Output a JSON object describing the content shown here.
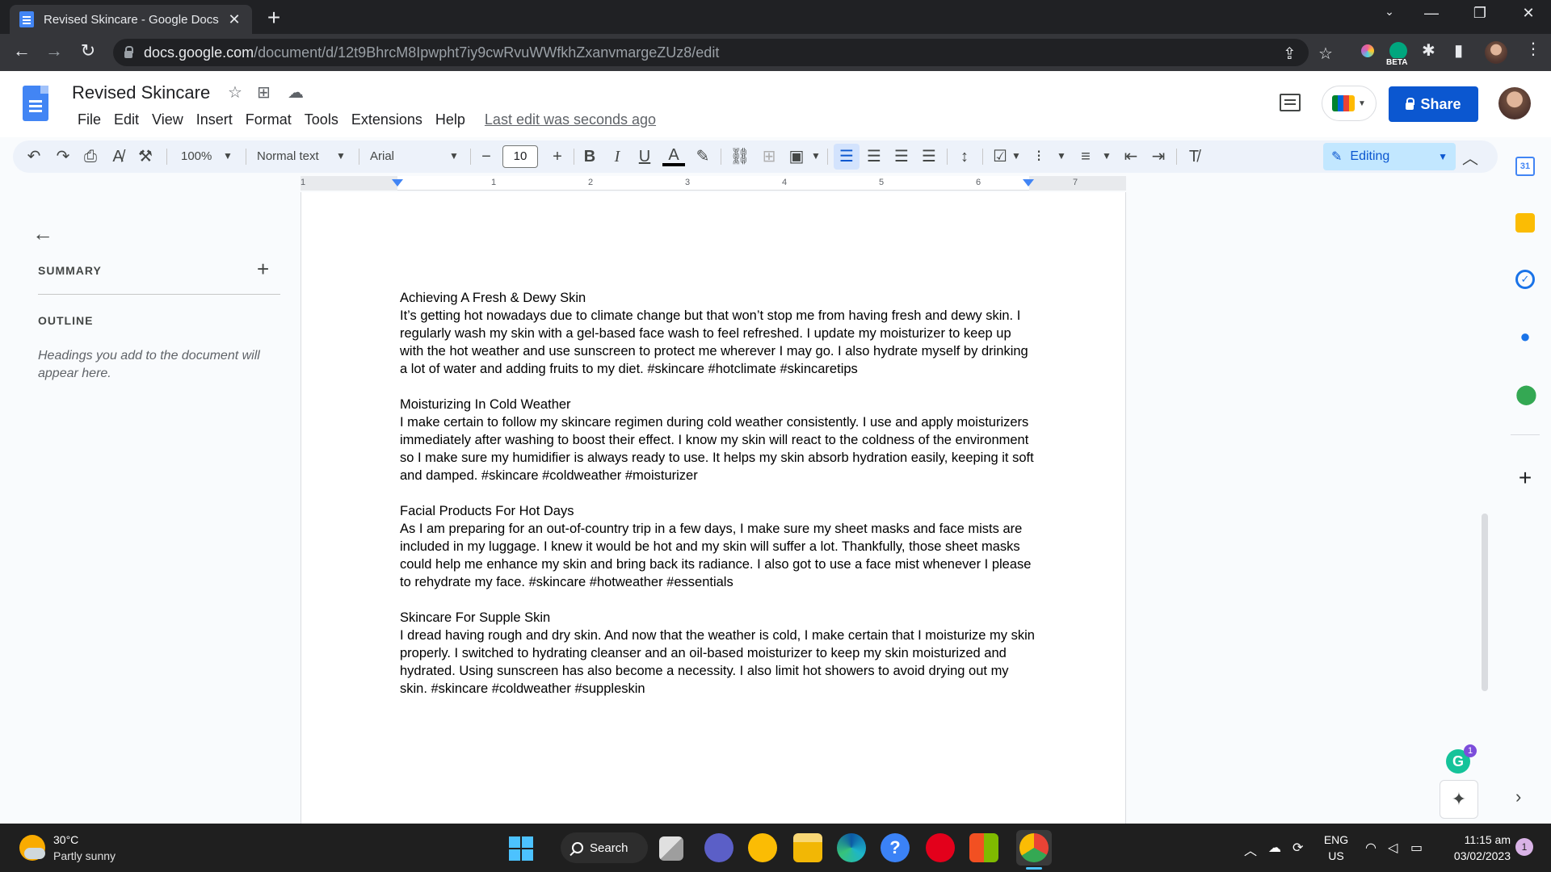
{
  "browser": {
    "tab_title": "Revised Skincare - Google Docs",
    "tab_close": "✕",
    "new_tab": "+",
    "url_host": "docs.google.com",
    "url_path": "/document/d/12t9BhrcM8Ipwpht7iy9cwRvuWWfkhZxanvmargeZUz8/edit",
    "ext_beta_label": "BETA"
  },
  "docs": {
    "title": "Revised Skincare",
    "menu": [
      "File",
      "Edit",
      "View",
      "Insert",
      "Format",
      "Tools",
      "Extensions",
      "Help"
    ],
    "last_edit": "Last edit was seconds ago",
    "share_label": "Share"
  },
  "toolbar": {
    "zoom": "100%",
    "style": "Normal text",
    "font": "Arial",
    "font_size": "10",
    "mode": "Editing"
  },
  "ruler": {
    "numbers": [
      "1",
      "1",
      "2",
      "3",
      "4",
      "5",
      "6",
      "7"
    ]
  },
  "sidebar": {
    "summary_label": "SUMMARY",
    "outline_label": "OUTLINE",
    "outline_hint": "Headings you add to the document will appear here."
  },
  "document": {
    "sections": [
      {
        "heading": "Achieving A Fresh & Dewy Skin",
        "body": "It’s getting hot nowadays due to climate change but that won’t stop me from having fresh and dewy skin. I regularly wash my skin with a gel-based face wash to feel refreshed. I update my moisturizer to keep up with the hot weather and use sunscreen to protect me wherever I may go. I also hydrate myself by drinking a lot of water and adding fruits to my diet. #skincare #hotclimate #skincaretips"
      },
      {
        "heading": "Moisturizing In Cold Weather",
        "body": "I make certain to follow my skincare regimen during cold weather consistently. I use and apply moisturizers immediately after washing to boost their effect. I know my skin will react to the coldness of the environment so I make sure my humidifier is always ready to use. It helps my skin absorb hydration easily, keeping it soft and damped. #skincare #coldweather #moisturizer"
      },
      {
        "heading": "Facial Products For Hot Days",
        "body": "As I am preparing for an out-of-country trip in a few days, I make sure my sheet masks and face mists are included in my luggage. I knew it would be hot and my skin will suffer a lot. Thankfully, those sheet masks could help me enhance my skin and bring back its radiance. I also got to use a face mist whenever I please to rehydrate my face. #skincare #hotweather #essentials"
      },
      {
        "heading": "Skincare For Supple Skin",
        "body": "I dread having rough and dry skin. And now that the weather is cold, I make certain that I moisturize my skin properly. I switched to hydrating cleanser and an oil-based moisturizer to keep my skin moisturized and hydrated. Using sunscreen has also become a necessity. I also limit hot showers to avoid drying out my skin. #skincare #coldweather #suppleskin"
      }
    ]
  },
  "side_panel": {
    "calendar_day": "31",
    "grammarly_count": "1"
  },
  "taskbar": {
    "weather_temp": "30°C",
    "weather_desc": "Partly sunny",
    "search_label": "Search",
    "lang_top": "ENG",
    "lang_bottom": "US",
    "time": "11:15 am",
    "date": "03/02/2023",
    "notification_count": "1"
  },
  "colors": {
    "brand_blue": "#0b57d0",
    "docs_blue": "#4285f4",
    "editing_bg": "#c2e7ff",
    "chrome_dark": "#202124"
  }
}
